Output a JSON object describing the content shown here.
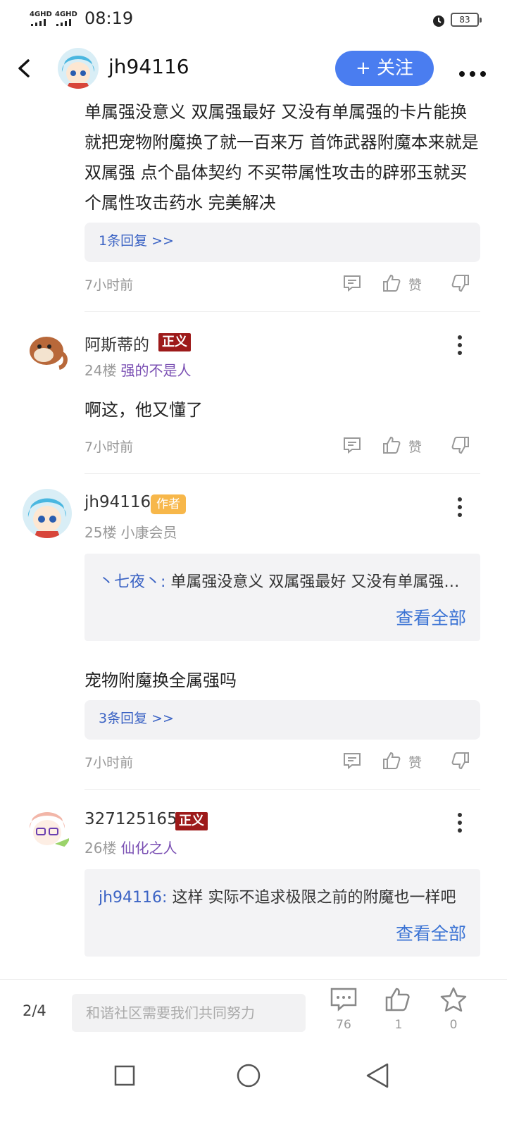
{
  "status": {
    "signal1": "4GHD",
    "signal2": "4GHD",
    "time": "08:19",
    "battery": "83"
  },
  "header": {
    "username": "jh94116",
    "follow_label": "+ 关注"
  },
  "post": {
    "content": "单属强没意义 双属强最好 又没有单属强的卡片能换就把宠物附魔换了就一百来万 首饰武器附魔本来就是双属强 点个晶体契约 不买带属性攻击的辟邪玉就买个属性攻击药水 完美解决",
    "replies_link": "1条回复 >>",
    "time": "7小时前",
    "like_label": "赞"
  },
  "comments": [
    {
      "name": "阿斯蒂的",
      "badge": "正义",
      "floor": "24楼",
      "tag": "强的不是人",
      "text": "啊这，他又懂了",
      "time": "7小时前",
      "like_label": "赞"
    },
    {
      "name": "jh94116",
      "badge": "作者",
      "floor": "25楼",
      "tag": "小康会员",
      "quote_author": "丶七夜丶:",
      "quote_text": " 单属强没意义 双属强最好 又没有单属强…",
      "view_all": "查看全部",
      "text": "宠物附魔换全属强吗",
      "replies_link": "3条回复 >>",
      "time": "7小时前",
      "like_label": "赞"
    },
    {
      "name": "327125165",
      "badge": "正义",
      "floor": "26楼",
      "tag": "仙化之人",
      "quote_author": "jh94116:",
      "quote_text": " 这样 实际不追求极限之前的附魔也一样吧",
      "view_all": "查看全部"
    }
  ],
  "bottom": {
    "page": "2/4",
    "input_placeholder": "和谐社区需要我们共同努力",
    "comment_count": "76",
    "like_count": "1",
    "star_count": "0"
  },
  "colors": {
    "accent": "#4a7df0",
    "link": "#3b63c4",
    "badge_red": "#9d1a1a",
    "badge_author": "#f7b74a",
    "tag_purple": "#7a4fb3"
  }
}
